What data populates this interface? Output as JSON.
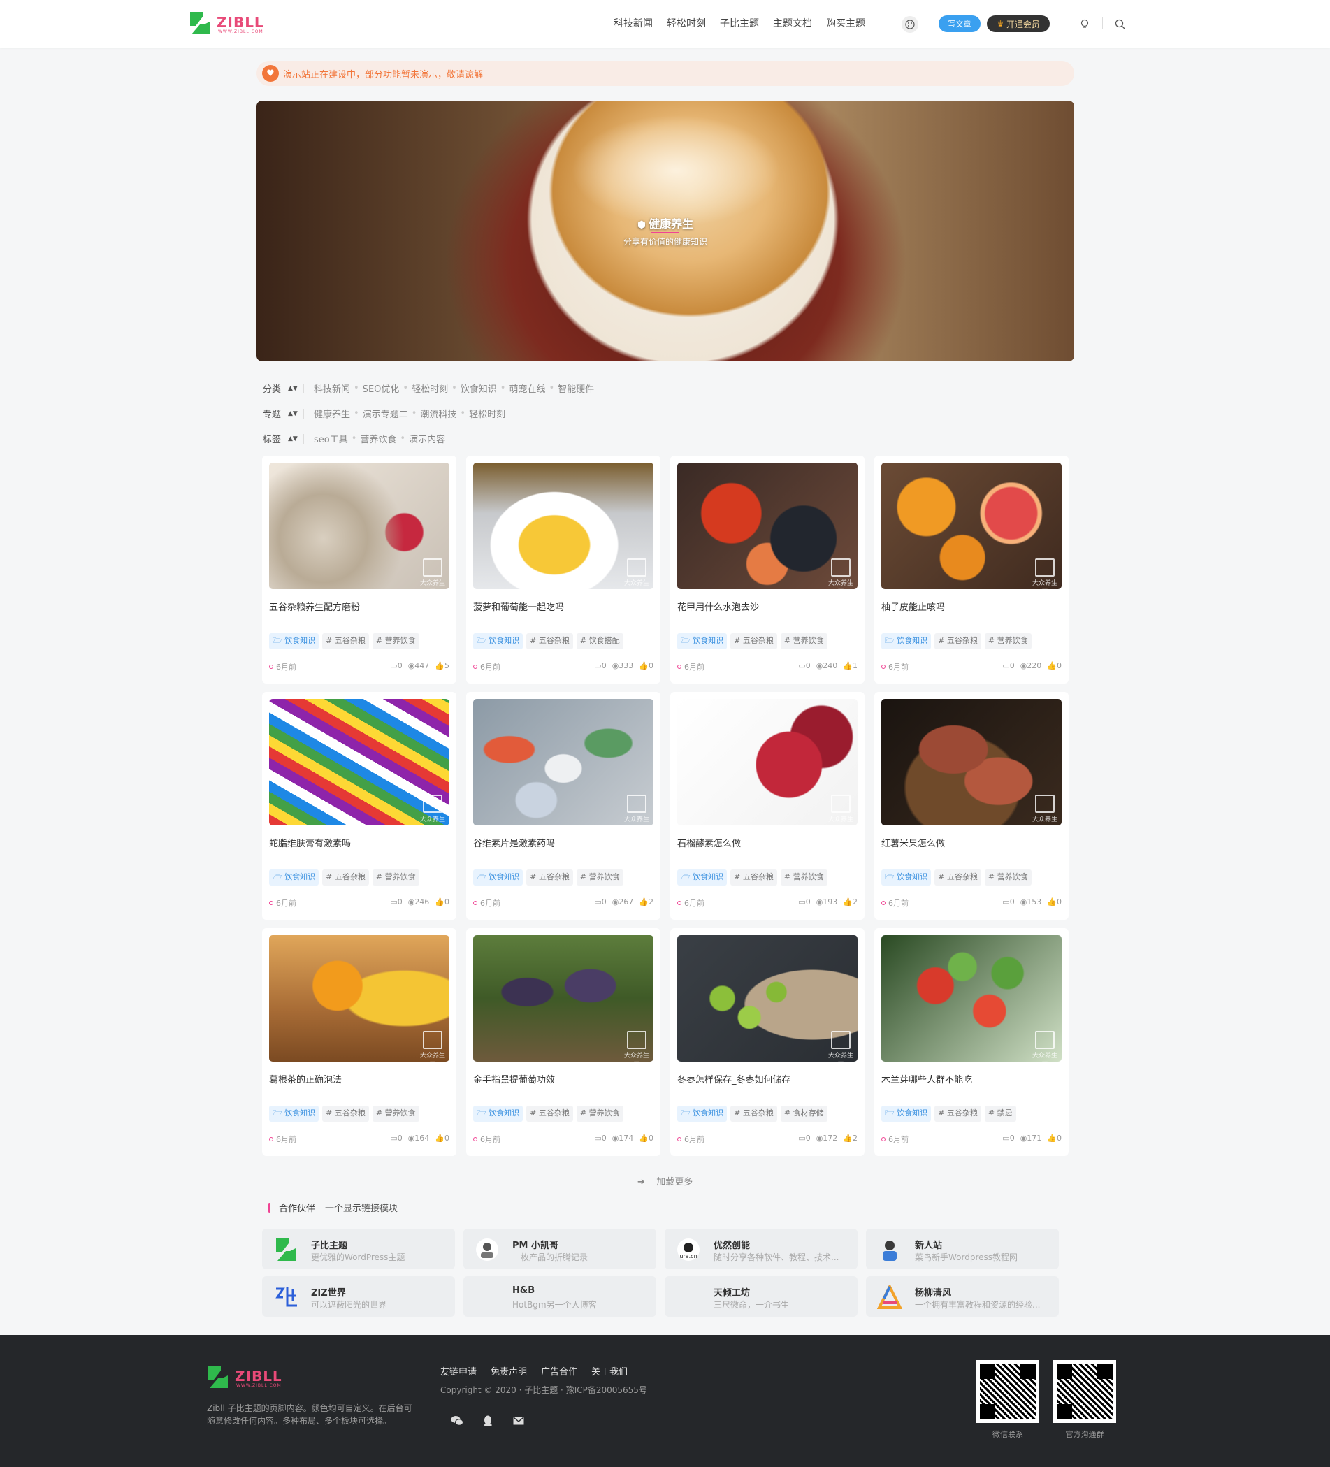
{
  "header": {
    "logo_text": "ZIBLL",
    "logo_sub": "WWW.ZIBLL.COM",
    "nav": [
      "科技新闻",
      "轻松时刻",
      "子比主题",
      "主题文档",
      "购买主题"
    ],
    "write_label": "写文章",
    "vip_label": "开通会员"
  },
  "notice": {
    "text": "演示站正在建设中，部分功能暂未演示，敬请谅解"
  },
  "banner": {
    "title": "健康养生",
    "subtitle": "分享有价值的健康知识"
  },
  "filters": [
    {
      "label": "分类",
      "items": [
        "科技新闻",
        "SEO优化",
        "轻松时刻",
        "饮食知识",
        "萌宠在线",
        "智能硬件"
      ]
    },
    {
      "label": "专题",
      "items": [
        "健康养生",
        "演示专题二",
        "潮流科技",
        "轻松时刻"
      ]
    },
    {
      "label": "标签",
      "items": [
        "seo工具",
        "营养饮食",
        "演示内容"
      ]
    }
  ],
  "watermark": "大众养生网",
  "posts": [
    {
      "title": "五谷杂粮养生配方磨粉",
      "category": "饮食知识",
      "tags": [
        "# 五谷杂粮",
        "# 营养饮食"
      ],
      "time": "6月前",
      "comments": "0",
      "views": "447",
      "likes": "5"
    },
    {
      "title": "菠萝和葡萄能一起吃吗",
      "category": "饮食知识",
      "tags": [
        "# 五谷杂粮",
        "# 饮食搭配"
      ],
      "time": "6月前",
      "comments": "0",
      "views": "333",
      "likes": "0"
    },
    {
      "title": "花甲用什么水泡去沙",
      "category": "饮食知识",
      "tags": [
        "# 五谷杂粮",
        "# 营养饮食"
      ],
      "time": "6月前",
      "comments": "0",
      "views": "240",
      "likes": "1"
    },
    {
      "title": "柚子皮能止咳吗",
      "category": "饮食知识",
      "tags": [
        "# 五谷杂粮",
        "# 营养饮食"
      ],
      "time": "6月前",
      "comments": "0",
      "views": "220",
      "likes": "0"
    },
    {
      "title": "蛇脂维肤膏有激素吗",
      "category": "饮食知识",
      "tags": [
        "# 五谷杂粮",
        "# 营养饮食"
      ],
      "time": "6月前",
      "comments": "0",
      "views": "246",
      "likes": "0"
    },
    {
      "title": "谷维素片是激素药吗",
      "category": "饮食知识",
      "tags": [
        "# 五谷杂粮",
        "# 营养饮食"
      ],
      "time": "6月前",
      "comments": "0",
      "views": "267",
      "likes": "2"
    },
    {
      "title": "石榴酵素怎么做",
      "category": "饮食知识",
      "tags": [
        "# 五谷杂粮",
        "# 营养饮食"
      ],
      "time": "6月前",
      "comments": "0",
      "views": "193",
      "likes": "2"
    },
    {
      "title": "红薯米果怎么做",
      "category": "饮食知识",
      "tags": [
        "# 五谷杂粮",
        "# 营养饮食"
      ],
      "time": "6月前",
      "comments": "0",
      "views": "153",
      "likes": "0"
    },
    {
      "title": "葛根茶的正确泡法",
      "category": "饮食知识",
      "tags": [
        "# 五谷杂粮",
        "# 营养饮食"
      ],
      "time": "6月前",
      "comments": "0",
      "views": "164",
      "likes": "0"
    },
    {
      "title": "金手指黑提葡萄功效",
      "category": "饮食知识",
      "tags": [
        "# 五谷杂粮",
        "# 营养饮食"
      ],
      "time": "6月前",
      "comments": "0",
      "views": "174",
      "likes": "0"
    },
    {
      "title": "冬枣怎样保存_冬枣如何储存",
      "category": "饮食知识",
      "tags": [
        "# 五谷杂粮",
        "# 食材存储"
      ],
      "time": "6月前",
      "comments": "0",
      "views": "172",
      "likes": "2"
    },
    {
      "title": "木兰芽哪些人群不能吃",
      "category": "饮食知识",
      "tags": [
        "# 五谷杂粮",
        "# 禁忌"
      ],
      "time": "6月前",
      "comments": "0",
      "views": "171",
      "likes": "0"
    }
  ],
  "load_more": "加载更多",
  "partners": {
    "title": "合作伙伴",
    "subtitle": "一个显示链接模块",
    "links": [
      {
        "name": "子比主题",
        "desc": "更优雅的WordPress主题"
      },
      {
        "name": "PM 小凯哥",
        "desc": "一枚产品的折腾记录"
      },
      {
        "name": "优然创能",
        "desc": "随时分享各种软件、教程、技术..."
      },
      {
        "name": "新人站",
        "desc": "菜鸟新手Wordpress教程网"
      },
      {
        "name": "ZIZ世界",
        "desc": "可以遮蔽阳光的世界"
      },
      {
        "name": "H&B",
        "desc": "HotBgm另一个人博客"
      },
      {
        "name": "天倾工坊",
        "desc": "三尺微命，一介书生"
      },
      {
        "name": "杨柳清风",
        "desc": "一个拥有丰富教程和资源的经验..."
      }
    ]
  },
  "footer": {
    "desc": "Zibll 子比主题的页脚内容。颜色均可自定义。在后台可随意修改任何内容。多种布局、多个板块可选择。",
    "links": [
      "友链申请",
      "免责声明",
      "广告合作",
      "关于我们"
    ],
    "copyright": "Copyright © 2020 · 子比主题 · 豫ICP备20005655号",
    "qr_labels": [
      "微信联系",
      "官方沟通群"
    ]
  },
  "colors": {
    "accent": "#f04494",
    "brand_green": "#2fb94c",
    "notice": "#f2763a",
    "category": "#3a91e0"
  }
}
